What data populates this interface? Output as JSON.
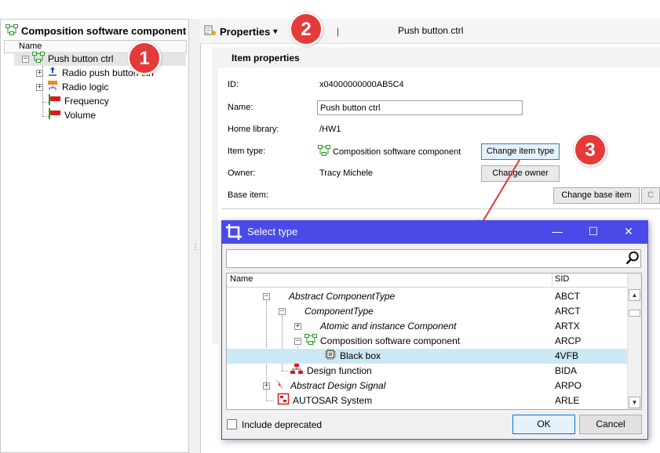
{
  "left_panel": {
    "title": "Composition software component",
    "column_header": "Name",
    "tree": [
      {
        "label": "Push button ctrl",
        "selected": true,
        "icon": "composition-icon",
        "expander": "−"
      },
      {
        "label": "Radio push button ctrl",
        "icon": "push-button-signal-icon",
        "expander": "+"
      },
      {
        "label": "Radio logic",
        "icon": "logic-icon",
        "expander": "+"
      },
      {
        "label": "Frequency",
        "icon": "port-flag-icon"
      },
      {
        "label": "Volume",
        "icon": "port-flag-icon"
      }
    ]
  },
  "toolbar": {
    "properties_label": "Properties",
    "dropdown_arrow": "▾",
    "separator": "|",
    "title": "Push button ctrl"
  },
  "properties": {
    "section_title": "Item properties",
    "id_label": "ID:",
    "id_value": "x04000000000AB5C4",
    "name_label": "Name:",
    "name_value": "Push button ctrl",
    "home_library_label": "Home library:",
    "home_library_value": "/HW1",
    "item_type_label": "Item type:",
    "item_type_value": "Composition software component",
    "change_item_type_button": "Change item type",
    "owner_label": "Owner:",
    "owner_value": "Tracy Michele",
    "change_owner_button": "Change owner",
    "base_item_label": "Base item:",
    "change_base_item_button": "Change base item",
    "cut_button_text": "C"
  },
  "callouts": [
    "1",
    "2",
    "3"
  ],
  "dialog": {
    "title": "Select type",
    "minimize": "—",
    "maximize": "☐",
    "close": "✕",
    "search_placeholder": "",
    "columns": {
      "name": "Name",
      "sid": "SID"
    },
    "rows": [
      {
        "name": "Abstract ComponentType",
        "sid": "ABCT",
        "italic": true,
        "expander": "−"
      },
      {
        "name": "ComponentType",
        "sid": "ARCT",
        "italic": true,
        "expander": "−"
      },
      {
        "name": "Atomic and instance Component",
        "sid": "ARTX",
        "italic": true,
        "expander": "+"
      },
      {
        "name": "Composition software component",
        "sid": "ARCP",
        "italic": false,
        "expander": "−",
        "icon": "composition-icon"
      },
      {
        "name": "Black box",
        "sid": "4VFB",
        "italic": false,
        "selected": true,
        "icon": "chip-icon"
      },
      {
        "name": "Design function",
        "sid": "BIDA",
        "italic": false,
        "icon": "design-function-icon"
      },
      {
        "name": "Abstract Design Signal",
        "sid": "ARPO",
        "italic": true,
        "expander": "+",
        "icon": "lightning-icon"
      },
      {
        "name": "AUTOSAR System",
        "sid": "ARLE",
        "italic": false,
        "icon": "autosar-system-icon"
      }
    ],
    "include_deprecated_label": "Include deprecated",
    "include_deprecated_checked": false,
    "ok_button": "OK",
    "cancel_button": "Cancel"
  },
  "colors": {
    "dialog_titlebar": "#4a4ae8",
    "callout_red": "#e43a3a",
    "selection_blue": "#cce8f4",
    "selection_gray": "#e5e5e5"
  }
}
